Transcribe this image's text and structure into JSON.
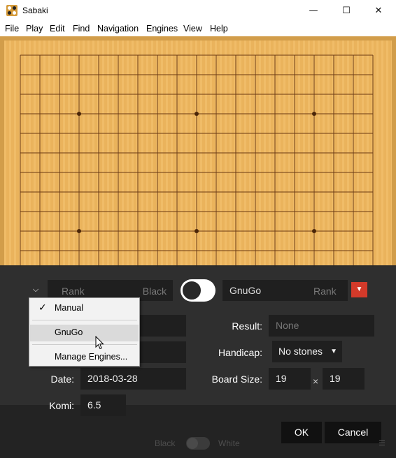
{
  "window": {
    "title": "Sabaki",
    "minimize": "—",
    "maximize": "☐",
    "close": "✕"
  },
  "menu": [
    "File",
    "Play",
    "Edit",
    "Find",
    "Navigation",
    "Engines",
    "View",
    "Help"
  ],
  "players": {
    "left": {
      "rank_placeholder": "Rank",
      "name_placeholder": "Black"
    },
    "right": {
      "name": "GnuGo",
      "rank_placeholder": "Rank"
    }
  },
  "fields": {
    "result_label": "Result:",
    "result_placeholder": "None",
    "handicap_label": "Handicap:",
    "handicap_value": "No stones",
    "date_label": "Date:",
    "date_value": "2018-03-28",
    "board_size_label": "Board Size:",
    "board_width": "19",
    "board_height": "19",
    "times": "×",
    "komi_label": "Komi:",
    "komi_value": "6.5"
  },
  "buttons": {
    "ok": "OK",
    "cancel": "Cancel"
  },
  "engine_menu": {
    "items": [
      {
        "label": "Manual",
        "checked": true
      },
      {
        "label": "GnuGo",
        "checked": false,
        "hovered": true
      },
      {
        "label": "Manage Engines...",
        "checked": false
      }
    ]
  },
  "background_bar": {
    "black": "Black",
    "white": "White"
  },
  "icons": {
    "chevron": "chevron-down-icon",
    "red_dropdown": "caret-down-icon",
    "check": "checkmark-icon",
    "cursor": "mouse-pointer-icon"
  },
  "colors": {
    "board": "#efb860",
    "board_frame": "#d29d4a",
    "dialog": "#282828",
    "field": "#1f1f1f",
    "accent": "#d33a2a"
  }
}
